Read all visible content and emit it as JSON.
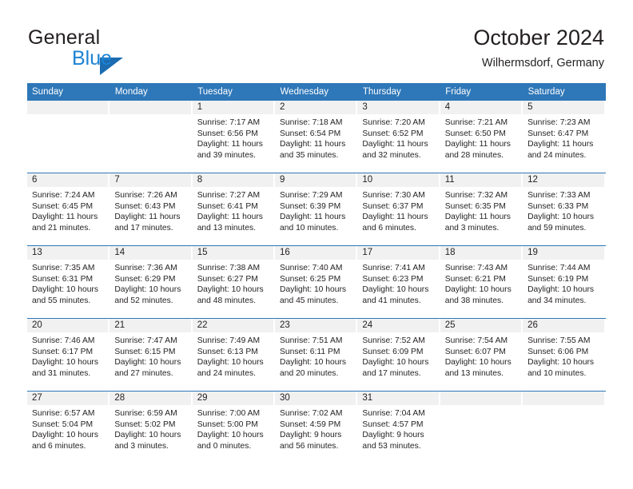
{
  "brand": {
    "name_part1": "General",
    "name_part2": "Blue",
    "logo_icon": "triangle-logo-icon",
    "accent_color": "#1b6cb0",
    "secondary_color": "#1c83d4"
  },
  "header": {
    "title": "October 2024",
    "subtitle": "Wilhermsdorf, Germany"
  },
  "calendar": {
    "header_background": "#2e77b8",
    "date_band_background": "#f1f1f1",
    "weekday_headers": [
      "Sunday",
      "Monday",
      "Tuesday",
      "Wednesday",
      "Thursday",
      "Friday",
      "Saturday"
    ],
    "weeks": [
      [
        {
          "day": "",
          "sunrise": "",
          "sunset": "",
          "daylight": ""
        },
        {
          "day": "",
          "sunrise": "",
          "sunset": "",
          "daylight": ""
        },
        {
          "day": "1",
          "sunrise": "Sunrise: 7:17 AM",
          "sunset": "Sunset: 6:56 PM",
          "daylight": "Daylight: 11 hours and 39 minutes."
        },
        {
          "day": "2",
          "sunrise": "Sunrise: 7:18 AM",
          "sunset": "Sunset: 6:54 PM",
          "daylight": "Daylight: 11 hours and 35 minutes."
        },
        {
          "day": "3",
          "sunrise": "Sunrise: 7:20 AM",
          "sunset": "Sunset: 6:52 PM",
          "daylight": "Daylight: 11 hours and 32 minutes."
        },
        {
          "day": "4",
          "sunrise": "Sunrise: 7:21 AM",
          "sunset": "Sunset: 6:50 PM",
          "daylight": "Daylight: 11 hours and 28 minutes."
        },
        {
          "day": "5",
          "sunrise": "Sunrise: 7:23 AM",
          "sunset": "Sunset: 6:47 PM",
          "daylight": "Daylight: 11 hours and 24 minutes."
        }
      ],
      [
        {
          "day": "6",
          "sunrise": "Sunrise: 7:24 AM",
          "sunset": "Sunset: 6:45 PM",
          "daylight": "Daylight: 11 hours and 21 minutes."
        },
        {
          "day": "7",
          "sunrise": "Sunrise: 7:26 AM",
          "sunset": "Sunset: 6:43 PM",
          "daylight": "Daylight: 11 hours and 17 minutes."
        },
        {
          "day": "8",
          "sunrise": "Sunrise: 7:27 AM",
          "sunset": "Sunset: 6:41 PM",
          "daylight": "Daylight: 11 hours and 13 minutes."
        },
        {
          "day": "9",
          "sunrise": "Sunrise: 7:29 AM",
          "sunset": "Sunset: 6:39 PM",
          "daylight": "Daylight: 11 hours and 10 minutes."
        },
        {
          "day": "10",
          "sunrise": "Sunrise: 7:30 AM",
          "sunset": "Sunset: 6:37 PM",
          "daylight": "Daylight: 11 hours and 6 minutes."
        },
        {
          "day": "11",
          "sunrise": "Sunrise: 7:32 AM",
          "sunset": "Sunset: 6:35 PM",
          "daylight": "Daylight: 11 hours and 3 minutes."
        },
        {
          "day": "12",
          "sunrise": "Sunrise: 7:33 AM",
          "sunset": "Sunset: 6:33 PM",
          "daylight": "Daylight: 10 hours and 59 minutes."
        }
      ],
      [
        {
          "day": "13",
          "sunrise": "Sunrise: 7:35 AM",
          "sunset": "Sunset: 6:31 PM",
          "daylight": "Daylight: 10 hours and 55 minutes."
        },
        {
          "day": "14",
          "sunrise": "Sunrise: 7:36 AM",
          "sunset": "Sunset: 6:29 PM",
          "daylight": "Daylight: 10 hours and 52 minutes."
        },
        {
          "day": "15",
          "sunrise": "Sunrise: 7:38 AM",
          "sunset": "Sunset: 6:27 PM",
          "daylight": "Daylight: 10 hours and 48 minutes."
        },
        {
          "day": "16",
          "sunrise": "Sunrise: 7:40 AM",
          "sunset": "Sunset: 6:25 PM",
          "daylight": "Daylight: 10 hours and 45 minutes."
        },
        {
          "day": "17",
          "sunrise": "Sunrise: 7:41 AM",
          "sunset": "Sunset: 6:23 PM",
          "daylight": "Daylight: 10 hours and 41 minutes."
        },
        {
          "day": "18",
          "sunrise": "Sunrise: 7:43 AM",
          "sunset": "Sunset: 6:21 PM",
          "daylight": "Daylight: 10 hours and 38 minutes."
        },
        {
          "day": "19",
          "sunrise": "Sunrise: 7:44 AM",
          "sunset": "Sunset: 6:19 PM",
          "daylight": "Daylight: 10 hours and 34 minutes."
        }
      ],
      [
        {
          "day": "20",
          "sunrise": "Sunrise: 7:46 AM",
          "sunset": "Sunset: 6:17 PM",
          "daylight": "Daylight: 10 hours and 31 minutes."
        },
        {
          "day": "21",
          "sunrise": "Sunrise: 7:47 AM",
          "sunset": "Sunset: 6:15 PM",
          "daylight": "Daylight: 10 hours and 27 minutes."
        },
        {
          "day": "22",
          "sunrise": "Sunrise: 7:49 AM",
          "sunset": "Sunset: 6:13 PM",
          "daylight": "Daylight: 10 hours and 24 minutes."
        },
        {
          "day": "23",
          "sunrise": "Sunrise: 7:51 AM",
          "sunset": "Sunset: 6:11 PM",
          "daylight": "Daylight: 10 hours and 20 minutes."
        },
        {
          "day": "24",
          "sunrise": "Sunrise: 7:52 AM",
          "sunset": "Sunset: 6:09 PM",
          "daylight": "Daylight: 10 hours and 17 minutes."
        },
        {
          "day": "25",
          "sunrise": "Sunrise: 7:54 AM",
          "sunset": "Sunset: 6:07 PM",
          "daylight": "Daylight: 10 hours and 13 minutes."
        },
        {
          "day": "26",
          "sunrise": "Sunrise: 7:55 AM",
          "sunset": "Sunset: 6:06 PM",
          "daylight": "Daylight: 10 hours and 10 minutes."
        }
      ],
      [
        {
          "day": "27",
          "sunrise": "Sunrise: 6:57 AM",
          "sunset": "Sunset: 5:04 PM",
          "daylight": "Daylight: 10 hours and 6 minutes."
        },
        {
          "day": "28",
          "sunrise": "Sunrise: 6:59 AM",
          "sunset": "Sunset: 5:02 PM",
          "daylight": "Daylight: 10 hours and 3 minutes."
        },
        {
          "day": "29",
          "sunrise": "Sunrise: 7:00 AM",
          "sunset": "Sunset: 5:00 PM",
          "daylight": "Daylight: 10 hours and 0 minutes."
        },
        {
          "day": "30",
          "sunrise": "Sunrise: 7:02 AM",
          "sunset": "Sunset: 4:59 PM",
          "daylight": "Daylight: 9 hours and 56 minutes."
        },
        {
          "day": "31",
          "sunrise": "Sunrise: 7:04 AM",
          "sunset": "Sunset: 4:57 PM",
          "daylight": "Daylight: 9 hours and 53 minutes."
        },
        {
          "day": "",
          "sunrise": "",
          "sunset": "",
          "daylight": ""
        },
        {
          "day": "",
          "sunrise": "",
          "sunset": "",
          "daylight": ""
        }
      ]
    ]
  }
}
